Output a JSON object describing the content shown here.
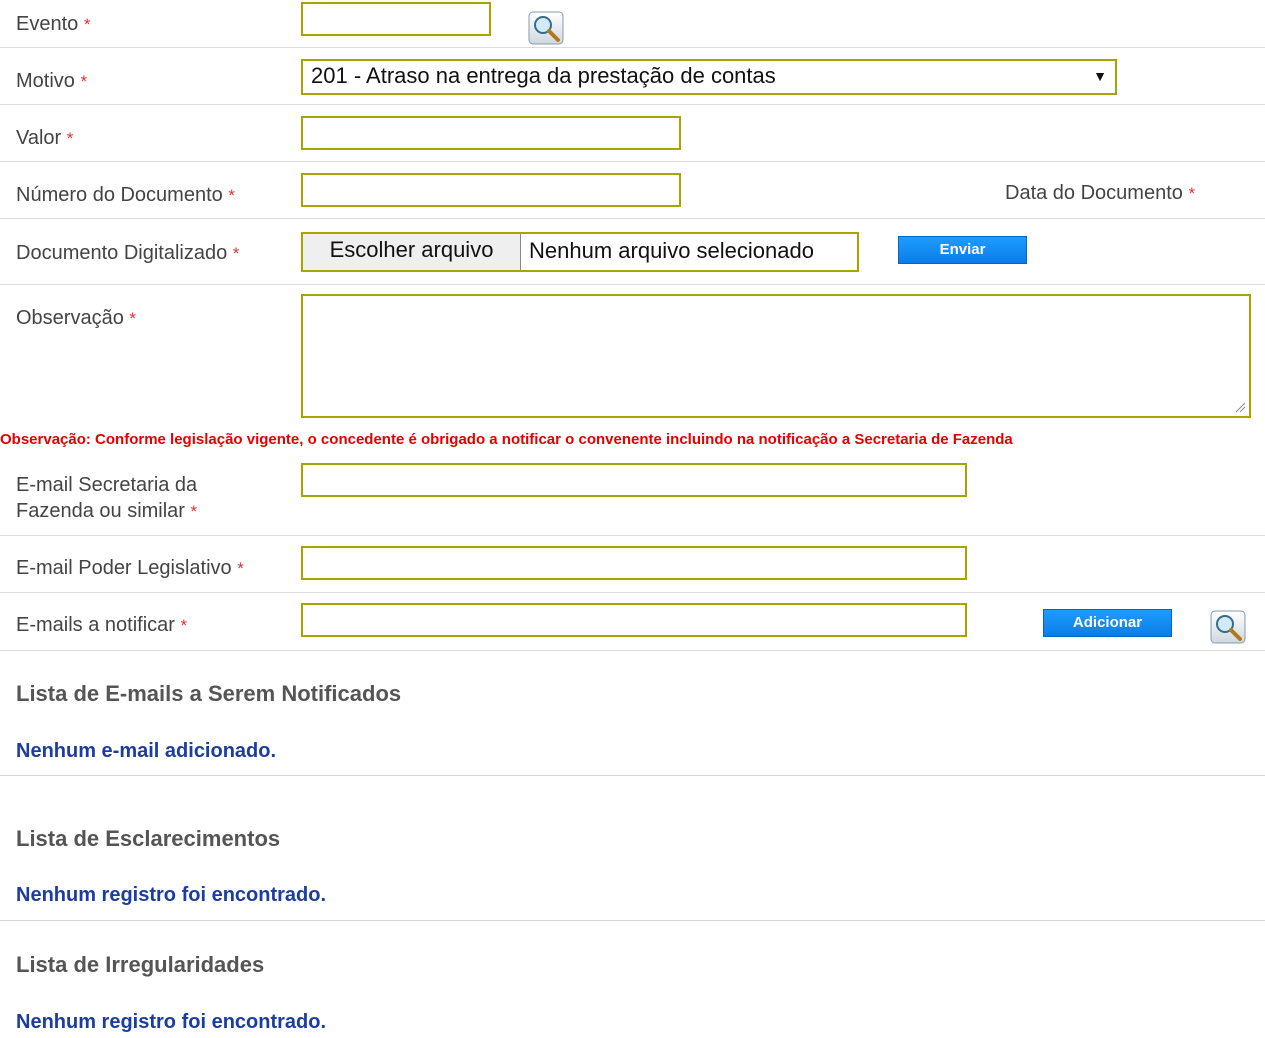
{
  "form": {
    "evento": {
      "label": "Evento",
      "required": "*",
      "value": ""
    },
    "motivo": {
      "label": "Motivo",
      "required": "*",
      "selected": "201 - Atraso na entrega da prestação de contas"
    },
    "valor": {
      "label": "Valor",
      "required": "*",
      "value": ""
    },
    "numero_documento": {
      "label": "Número do Documento",
      "required": "*",
      "value": ""
    },
    "data_documento": {
      "label": "Data do Documento",
      "required": "*"
    },
    "documento_digitalizado": {
      "label": "Documento Digitalizado",
      "required": "*",
      "choose_button": "Escolher arquivo",
      "file_status": "Nenhum arquivo selecionado",
      "send_button": "Enviar"
    },
    "observacao": {
      "label": "Observação",
      "required": "*",
      "value": ""
    },
    "notice": "Observação: Conforme legislação vigente, o concedente é obrigado a notificar o convenente incluindo na notificação a Secretaria de Fazenda",
    "email_fazenda": {
      "label_line1": "E-mail Secretaria da",
      "label_line2": "Fazenda ou similar",
      "required": "*",
      "value": ""
    },
    "email_legislativo": {
      "label": "E-mail Poder Legislativo",
      "required": "*",
      "value": ""
    },
    "emails_notificar": {
      "label": "E-mails a notificar",
      "required": "*",
      "value": "",
      "add_button": "Adicionar"
    }
  },
  "sections": {
    "emails": {
      "title": "Lista de E-mails a Serem Notificados",
      "message": "Nenhum e-mail adicionado."
    },
    "esclarecimentos": {
      "title": "Lista de Esclarecimentos",
      "message": "Nenhum registro foi encontrado."
    },
    "irregularidades": {
      "title": "Lista de Irregularidades",
      "message": "Nenhum registro foi encontrado."
    }
  },
  "icons": {
    "lookup": "magnifier-icon",
    "select_arrow": "dropdown-arrow-icon",
    "resize": "resize-grip-icon"
  },
  "colors": {
    "required": "#e23030",
    "input_border": "#a8a400",
    "button_blue": "#0a7de8",
    "notice_red": "#e60000",
    "message_blue": "#1b3da0"
  }
}
